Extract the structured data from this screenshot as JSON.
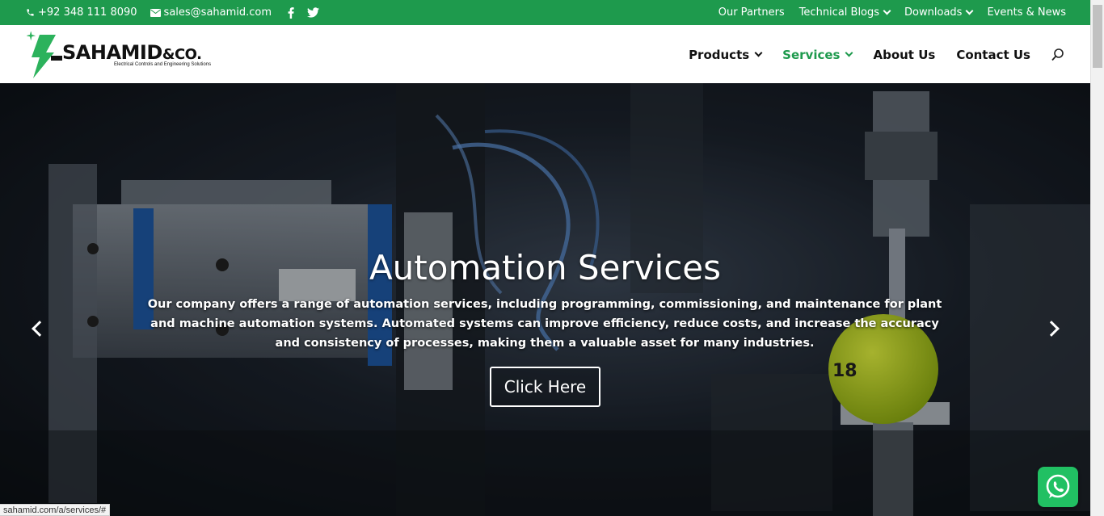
{
  "topbar": {
    "phone": "+92 348 111 8090",
    "email": "sales@sahamid.com",
    "social": [
      "facebook-icon",
      "twitter-icon"
    ],
    "links": [
      {
        "label": "Our Partners"
      },
      {
        "label": "Technical Blogs"
      },
      {
        "label": "Downloads"
      },
      {
        "label": "Events & News"
      }
    ]
  },
  "header": {
    "logo_name": "SAHAMID",
    "logo_suffix": "&CO.",
    "logo_tagline": "Electrical Controls and Engineering Solutions",
    "nav": [
      {
        "label": "Products"
      },
      {
        "label": "Services"
      },
      {
        "label": "About Us"
      },
      {
        "label": "Contact Us"
      }
    ]
  },
  "hero": {
    "title": "Automation Services",
    "text": "Our company offers a range of automation services, including programming, commissioning, and maintenance for plant and machine automation systems. Automated systems can improve efficiency, reduce costs, and increase the accuracy and consistency of processes, making them a valuable asset for many industries.",
    "button": "Click Here",
    "ball_label": "18"
  },
  "status_bar": {
    "url": "sahamid.com/a/services/#"
  },
  "colors": {
    "brand_green": "#1e9a4d",
    "whatsapp": "#21c063"
  }
}
